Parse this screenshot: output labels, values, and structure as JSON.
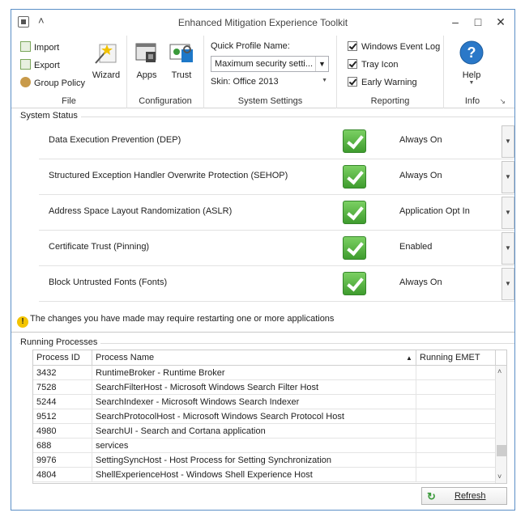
{
  "window": {
    "title": "Enhanced Mitigation Experience Toolkit"
  },
  "ribbon": {
    "file": {
      "label": "File",
      "items": [
        "Import",
        "Export",
        "Group Policy"
      ],
      "wizard": "Wizard"
    },
    "configuration": {
      "label": "Configuration",
      "apps": "Apps",
      "trust": "Trust"
    },
    "system_settings": {
      "label": "System Settings",
      "quick_profile_label": "Quick Profile Name:",
      "quick_profile_value": "Maximum security setti...",
      "skin": "Skin: Office 2013"
    },
    "reporting": {
      "label": "Reporting",
      "items": [
        "Windows Event Log",
        "Tray Icon",
        "Early Warning"
      ]
    },
    "info": {
      "label": "Info",
      "help": "Help"
    }
  },
  "system_status": {
    "label": "System Status",
    "rows": [
      {
        "name": "Data Execution Prevention (DEP)",
        "value": "Always On"
      },
      {
        "name": "Structured Exception Handler Overwrite Protection (SEHOP)",
        "value": "Always On"
      },
      {
        "name": "Address Space Layout Randomization (ASLR)",
        "value": "Application Opt In"
      },
      {
        "name": "Certificate Trust (Pinning)",
        "value": "Enabled"
      },
      {
        "name": "Block Untrusted Fonts (Fonts)",
        "value": "Always On"
      }
    ]
  },
  "warning": "The changes you have made may require restarting one or more applications",
  "processes": {
    "label": "Running Processes",
    "columns": [
      "Process ID",
      "Process Name",
      "Running EMET"
    ],
    "rows": [
      [
        "3432",
        "RuntimeBroker - Runtime Broker"
      ],
      [
        "7528",
        "SearchFilterHost - Microsoft Windows Search Filter Host"
      ],
      [
        "5244",
        "SearchIndexer - Microsoft Windows Search Indexer"
      ],
      [
        "9512",
        "SearchProtocolHost - Microsoft Windows Search Protocol Host"
      ],
      [
        "4980",
        "SearchUI - Search and Cortana application"
      ],
      [
        "688",
        "services"
      ],
      [
        "9976",
        "SettingSyncHost - Host Process for Setting Synchronization"
      ],
      [
        "4804",
        "ShellExperienceHost - Windows Shell Experience Host"
      ]
    ]
  },
  "refresh_label": "Refresh",
  "colors": {
    "accent": "#5b8fc7",
    "check_green": "#4caf3a",
    "warning_yellow": "#f3c400"
  }
}
